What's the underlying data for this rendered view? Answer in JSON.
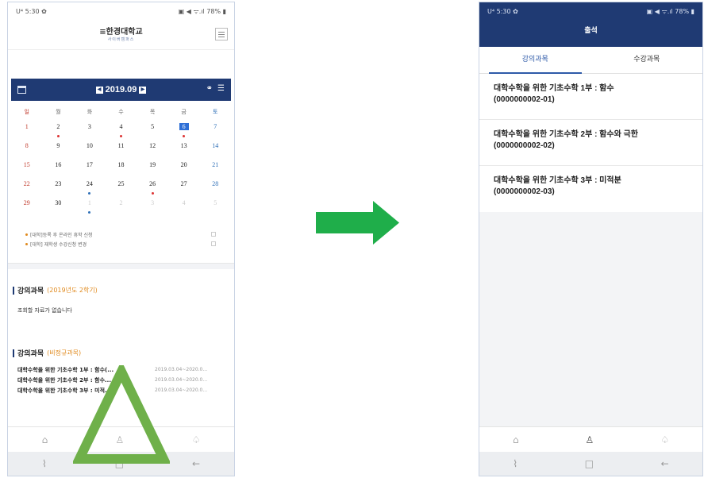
{
  "left": {
    "status": {
      "left": "U⁴ 5:30 ✿",
      "right": "▣ ◀ ᯤ.ıl 78% ▮"
    },
    "header": {
      "logo": "≡한경대학교",
      "sub": "사이버캠퍼스"
    },
    "calendar": {
      "month": "2019.09",
      "weekdays": [
        "일",
        "월",
        "화",
        "수",
        "목",
        "금",
        "토"
      ],
      "weeks": [
        [
          "1",
          "2",
          "3",
          "4",
          "5",
          "6",
          "7"
        ],
        [
          "8",
          "9",
          "10",
          "11",
          "12",
          "13",
          "14"
        ],
        [
          "15",
          "16",
          "17",
          "18",
          "19",
          "20",
          "21"
        ],
        [
          "22",
          "23",
          "24",
          "25",
          "26",
          "27",
          "28"
        ],
        [
          "29",
          "30",
          "1",
          "2",
          "3",
          "4",
          "5"
        ]
      ]
    },
    "notices": [
      "[대학]등록 후 온라인 휴학 신청",
      "[대학] 재학생 수강신청 변경"
    ],
    "section1": {
      "title": "강의과목",
      "tag": "(2019년도 2학기)",
      "empty": "조회할 자료가 없습니다"
    },
    "section2": {
      "title": "강의과목",
      "tag": "(비정규과목)"
    },
    "courses": [
      {
        "title": "대학수학을 위한 기초수학 1부 : 함수(...",
        "date": "2019.03.04~2020.0..."
      },
      {
        "title": "대학수학을 위한 기초수학 2부 : 함수...",
        "date": "2019.03.04~2020.0..."
      },
      {
        "title": "대학수학을 위한 기초수학 3부 : 미적...",
        "date": "2019.03.04~2020.0..."
      }
    ],
    "nav_icons": [
      "home-icon",
      "people-icon",
      "bell-icon"
    ],
    "sys_icons": [
      "recent-apps-icon",
      "home-square-icon",
      "back-icon"
    ]
  },
  "right": {
    "status": {
      "left": "U⁴ 5:30 ✿",
      "right": "▣ ◀ ᯤ.ıl 78% ▮"
    },
    "title": "출석",
    "tabs": [
      "강의과목",
      "수강과목"
    ],
    "items": [
      {
        "line1": "대학수학을 위한 기초수학 1부 : 함수",
        "line2": "(0000000002-01)"
      },
      {
        "line1": "대학수학을 위한 기초수학 2부 : 함수와 극한",
        "line2": "(0000000002-02)"
      },
      {
        "line1": "대학수학을 위한 기초수학 3부 : 미적분",
        "line2": "(0000000002-03)"
      }
    ]
  },
  "colors": {
    "navy": "#1f3a73",
    "arrow": "#1fae4a",
    "triangle": "#6fb04a",
    "accent_orange": "#e08a1e"
  }
}
